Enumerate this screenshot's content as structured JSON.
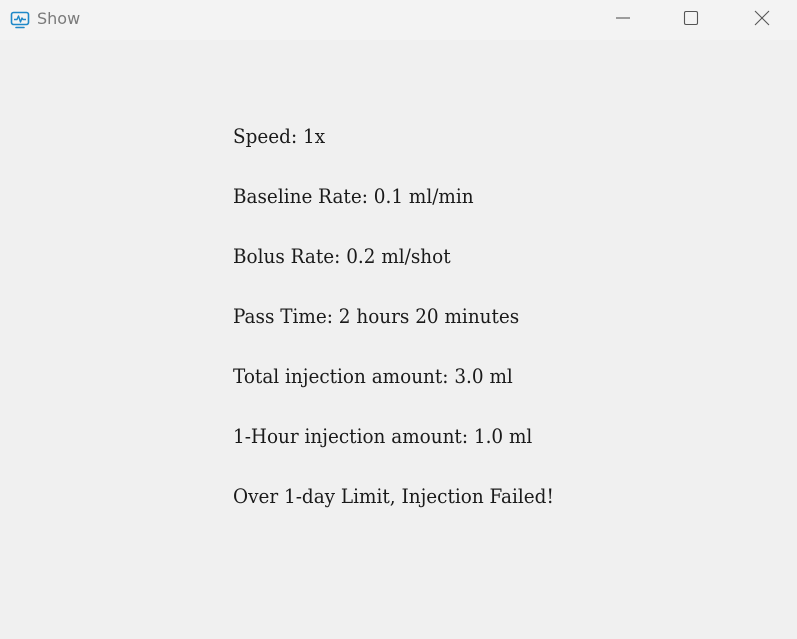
{
  "window": {
    "title": "Show",
    "app_icon": "monitor-chart-icon",
    "controls": {
      "minimize_icon": "minimize-icon",
      "maximize_icon": "maximize-icon",
      "close_icon": "close-icon"
    }
  },
  "info": {
    "speed": "Speed: 1x",
    "baseline_rate": "Baseline Rate: 0.1 ml/min",
    "bolus_rate": "Bolus Rate: 0.2 ml/shot",
    "pass_time": "Pass Time: 2 hours 20 minutes",
    "total_injection": "Total injection amount: 3.0 ml",
    "hour_injection": "1-Hour injection amount: 1.0 ml",
    "status": "Over 1-day Limit, Injection Failed!"
  }
}
